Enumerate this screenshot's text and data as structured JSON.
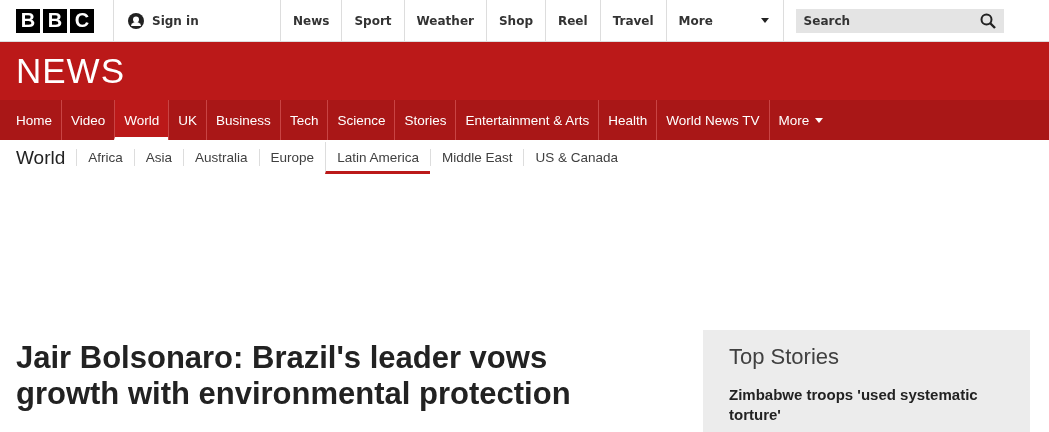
{
  "masthead": {
    "logo_letters": [
      "B",
      "B",
      "C"
    ],
    "sign_in": "Sign in",
    "links": [
      "News",
      "Sport",
      "Weather",
      "Shop",
      "Reel",
      "Travel"
    ],
    "more": "More",
    "search": {
      "placeholder": "Search"
    }
  },
  "banner": {
    "title": "NEWS"
  },
  "nav": [
    {
      "label": "Home",
      "selected": false
    },
    {
      "label": "Video",
      "selected": false
    },
    {
      "label": "World",
      "selected": true
    },
    {
      "label": "UK",
      "selected": false
    },
    {
      "label": "Business",
      "selected": false
    },
    {
      "label": "Tech",
      "selected": false
    },
    {
      "label": "Science",
      "selected": false
    },
    {
      "label": "Stories",
      "selected": false
    },
    {
      "label": "Entertainment & Arts",
      "selected": false
    },
    {
      "label": "Health",
      "selected": false
    },
    {
      "label": "World News TV",
      "selected": false
    },
    {
      "label": "More",
      "selected": false,
      "kind": "dropdown"
    }
  ],
  "subnav": {
    "title": "World",
    "items": [
      {
        "label": "Africa",
        "selected": false
      },
      {
        "label": "Asia",
        "selected": false
      },
      {
        "label": "Australia",
        "selected": false
      },
      {
        "label": "Europe",
        "selected": false
      },
      {
        "label": "Latin America",
        "selected": true
      },
      {
        "label": "Middle East",
        "selected": false
      },
      {
        "label": "US & Canada",
        "selected": false
      }
    ]
  },
  "article": {
    "headline": "Jair Bolsonaro: Brazil's leader vows growth with environmental protection"
  },
  "top_stories": {
    "title": "Top Stories",
    "items": [
      "Zimbabwe troops 'used systematic torture'"
    ]
  }
}
